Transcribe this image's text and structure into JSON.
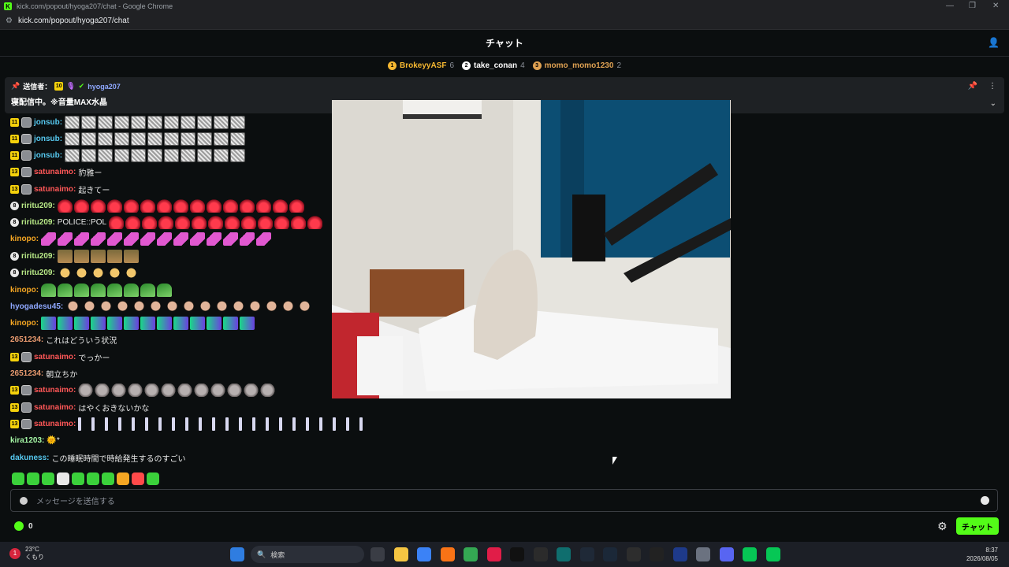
{
  "browser": {
    "title": "kick.com/popout/hyoga207/chat - Google Chrome",
    "url": "kick.com/popout/hyoga207/chat",
    "controls": [
      "—",
      "❐",
      "✕"
    ]
  },
  "chat": {
    "header_title": "チャット",
    "leaderboard": [
      {
        "rank": "1",
        "name": "BrokeyyASF",
        "count": "6",
        "color": "#f5b731"
      },
      {
        "rank": "2",
        "name": "take_conan",
        "count": "4",
        "color": "#ffffff"
      },
      {
        "rank": "3",
        "name": "momo_momo1230",
        "count": "2",
        "color": "#e0a253"
      }
    ],
    "pinned": {
      "sender_label": "送信者：",
      "badge": "10",
      "username": "hyoga207",
      "message": "寝配信中。※音量MAX水晶"
    },
    "messages": [
      {
        "badge": "11",
        "badge_type": "sub",
        "avatar": true,
        "user": "jonsub",
        "user_color": "#56c8ef",
        "text": "",
        "emote": "face",
        "emote_count": 11
      },
      {
        "badge": "11",
        "badge_type": "sub",
        "avatar": true,
        "user": "jonsub",
        "user_color": "#56c8ef",
        "text": "",
        "emote": "face",
        "emote_count": 11
      },
      {
        "badge": "11",
        "badge_type": "sub",
        "avatar": true,
        "user": "jonsub",
        "user_color": "#56c8ef",
        "text": "",
        "emote": "face",
        "emote_count": 11
      },
      {
        "badge": "13",
        "badge_type": "sub",
        "avatar": true,
        "user": "satunaimo",
        "user_color": "#ff5757",
        "text": "豹雅ー",
        "emote": "",
        "emote_count": 0
      },
      {
        "badge": "13",
        "badge_type": "sub",
        "avatar": true,
        "user": "satunaimo",
        "user_color": "#ff5757",
        "text": "起きてー",
        "emote": "",
        "emote_count": 0
      },
      {
        "badge": "8",
        "badge_type": "round",
        "avatar": false,
        "user": "riritu209",
        "user_color": "#b8e986",
        "text": "",
        "emote": "drop",
        "emote_count": 15
      },
      {
        "badge": "8",
        "badge_type": "round",
        "avatar": false,
        "user": "riritu209",
        "user_color": "#b8e986",
        "text": "POLICE::POL",
        "emote": "drop",
        "emote_count": 13
      },
      {
        "badge": "",
        "badge_type": "",
        "avatar": false,
        "user": "kinopo",
        "user_color": "#f5a623",
        "text": "",
        "emote": "pink",
        "emote_count": 14
      },
      {
        "badge": "8",
        "badge_type": "round",
        "avatar": false,
        "user": "riritu209",
        "user_color": "#b8e986",
        "text": "",
        "emote": "pic",
        "emote_count": 5
      },
      {
        "badge": "8",
        "badge_type": "round",
        "avatar": false,
        "user": "riritu209",
        "user_color": "#b8e986",
        "text": "",
        "emote": "hand",
        "emote_count": 5
      },
      {
        "badge": "",
        "badge_type": "",
        "avatar": false,
        "user": "kinopo",
        "user_color": "#f5a623",
        "text": "",
        "emote": "green",
        "emote_count": 8
      },
      {
        "badge": "",
        "badge_type": "",
        "avatar": false,
        "user": "hyogadesu45",
        "user_color": "#8fa8ff",
        "text": "",
        "emote": "man",
        "emote_count": 15
      },
      {
        "badge": "",
        "badge_type": "",
        "avatar": false,
        "user": "kinopo",
        "user_color": "#f5a623",
        "text": "",
        "emote": "mac",
        "emote_count": 13
      },
      {
        "badge": "",
        "badge_type": "",
        "avatar": false,
        "user": "2651234",
        "user_color": "#e89a6f",
        "text": "これはどういう状況",
        "emote": "",
        "emote_count": 0
      },
      {
        "badge": "13",
        "badge_type": "sub",
        "avatar": true,
        "user": "satunaimo",
        "user_color": "#ff5757",
        "text": "でっかー",
        "emote": "",
        "emote_count": 0
      },
      {
        "badge": "",
        "badge_type": "",
        "avatar": false,
        "user": "2651234",
        "user_color": "#e89a6f",
        "text": "朝立ちか",
        "emote": "",
        "emote_count": 0
      },
      {
        "badge": "13",
        "badge_type": "sub",
        "avatar": true,
        "user": "satunaimo",
        "user_color": "#ff5757",
        "text": "",
        "emote": "rock",
        "emote_count": 12
      },
      {
        "badge": "13",
        "badge_type": "sub",
        "avatar": true,
        "user": "satunaimo",
        "user_color": "#ff5757",
        "text": "はやくおきないかな",
        "emote": "",
        "emote_count": 0
      },
      {
        "badge": "13",
        "badge_type": "sub",
        "avatar": true,
        "user": "satunaimo",
        "user_color": "#ff5757",
        "text": "",
        "emote": "bar",
        "emote_count": 22
      },
      {
        "badge": "",
        "badge_type": "",
        "avatar": false,
        "user": "kira1203",
        "user_color": "#a4f5a4",
        "text": "🌞*",
        "emote": "",
        "emote_count": 0
      },
      {
        "badge": "",
        "badge_type": "",
        "avatar": false,
        "user": "dakuness",
        "user_color": "#56c8ef",
        "text": "この睡眠時間で時給発生するのすごい",
        "emote": "",
        "emote_count": 0
      }
    ],
    "quick_emotes": [
      "#3bd13b",
      "#3bd13b",
      "#3bd13b",
      "#e8e8e8",
      "#3bd13b",
      "#3bd13b",
      "#3bd13b",
      "#f5a623",
      "#ff4a4a",
      "#3bd13b"
    ],
    "composer_placeholder": "メッセージを送信する",
    "points": "0",
    "send_label": "チャット"
  },
  "taskbar": {
    "weather_temp": "23°C",
    "weather_desc": "くもり",
    "weather_badge": "1",
    "search_placeholder": "検索",
    "time": "8:37",
    "date": "2026/08/05",
    "apps": [
      "#3a3d45",
      "#f5c542",
      "#3b82f6",
      "#f97316",
      "#34a853",
      "#e11d48",
      "#111111",
      "#2b2b2b",
      "#0f6e6e",
      "#1f2937",
      "#1b2838",
      "#2d2d2d",
      "#222222",
      "#1e3a8a",
      "#6b7280",
      "#5865f2",
      "#06c755",
      "#06c755"
    ]
  }
}
